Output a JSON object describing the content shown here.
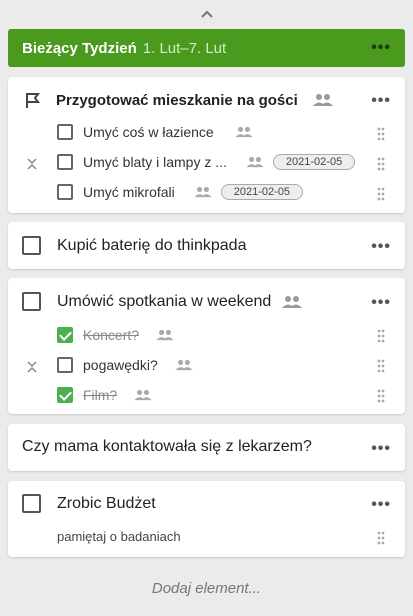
{
  "week": {
    "title": "Bieżący Tydzień",
    "range": "1. Lut–7. Lut",
    "menu": "•••"
  },
  "cards": {
    "c1": {
      "title": "Przygotować mieszkanie na gości",
      "menu": "•••",
      "sub": [
        {
          "label": "Umyć coś w łazience",
          "checked": false
        },
        {
          "label": "Umyć blaty i lampy z ...",
          "checked": false,
          "date": "2021-02-05"
        },
        {
          "label": "Umyć mikrofali",
          "checked": false,
          "date": "2021-02-05"
        }
      ]
    },
    "c2": {
      "title": "Kupić baterię do thinkpada",
      "menu": "•••"
    },
    "c3": {
      "title": "Umówić spotkania w weekend",
      "menu": "•••",
      "sub": [
        {
          "label": "Koncert?",
          "checked": true
        },
        {
          "label": "pogawędki?",
          "checked": false
        },
        {
          "label": "Film?",
          "checked": true
        }
      ]
    },
    "c4": {
      "title": "Czy mama kontaktowała się z lekarzem?",
      "menu": "•••"
    },
    "c5": {
      "title": "Zrobic Budżet",
      "menu": "•••",
      "note": "pamiętaj o badaniach"
    }
  },
  "footer": {
    "add_label": "Dodaj element..."
  },
  "colors": {
    "accent": "#4a9a1d",
    "check": "#4caf50"
  },
  "icons": [
    "chevron-up-icon",
    "flag-icon",
    "people-icon",
    "drag-handle-icon",
    "collapse-icon",
    "more-icon"
  ]
}
